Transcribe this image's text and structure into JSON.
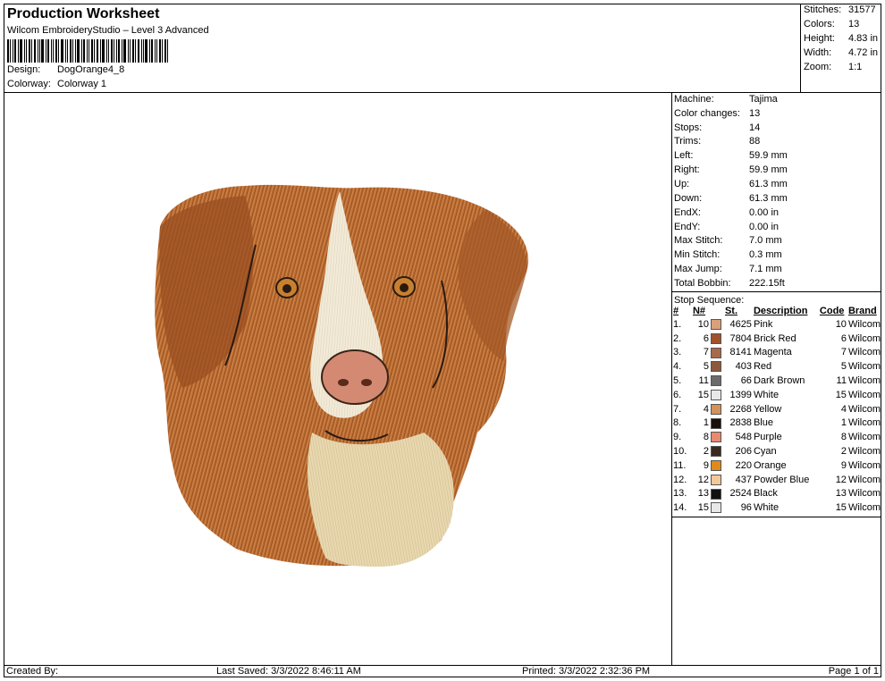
{
  "header": {
    "title": "Production Worksheet",
    "subtitle": "Wilcom EmbroideryStudio – Level 3 Advanced",
    "design_label": "Design:",
    "design_value": "DogOrange4_8",
    "colorway_label": "Colorway:",
    "colorway_value": "Colorway 1"
  },
  "stats": [
    {
      "label": "Stitches:",
      "value": "31577"
    },
    {
      "label": "Colors:",
      "value": "13"
    },
    {
      "label": "Height:",
      "value": "4.83 in"
    },
    {
      "label": "Width:",
      "value": "4.72 in"
    },
    {
      "label": "Zoom:",
      "value": "1:1"
    }
  ],
  "machine_info": [
    {
      "label": "Machine:",
      "value": "Tajima"
    },
    {
      "label": "Color changes:",
      "value": "13"
    },
    {
      "label": "Stops:",
      "value": "14"
    },
    {
      "label": "Trims:",
      "value": "88"
    },
    {
      "label": "Left:",
      "value": "59.9 mm"
    },
    {
      "label": "Right:",
      "value": "59.9 mm"
    },
    {
      "label": "Up:",
      "value": "61.3 mm"
    },
    {
      "label": "Down:",
      "value": "61.3 mm"
    },
    {
      "label": "EndX:",
      "value": "0.00 in"
    },
    {
      "label": "EndY:",
      "value": "0.00 in"
    },
    {
      "label": "Max Stitch:",
      "value": "7.0 mm"
    },
    {
      "label": "Min Stitch:",
      "value": "0.3 mm"
    },
    {
      "label": "Max Jump:",
      "value": "7.1 mm"
    },
    {
      "label": "Total Bobbin:",
      "value": "222.15ft"
    }
  ],
  "stop_sequence": {
    "title": "Stop Sequence:",
    "columns": [
      "#",
      "N#",
      "St.",
      "Description",
      "Code",
      "Brand"
    ],
    "rows": [
      {
        "num": "1.",
        "n": "10",
        "color": "#d9a07c",
        "st": "4625",
        "desc": "Pink",
        "code": "10",
        "brand": "Wilcom"
      },
      {
        "num": "2.",
        "n": "6",
        "color": "#a0522d",
        "st": "7804",
        "desc": "Brick Red",
        "code": "6",
        "brand": "Wilcom"
      },
      {
        "num": "3.",
        "n": "7",
        "color": "#a86a4a",
        "st": "8141",
        "desc": "Magenta",
        "code": "7",
        "brand": "Wilcom"
      },
      {
        "num": "4.",
        "n": "5",
        "color": "#8b5a3c",
        "st": "403",
        "desc": "Red",
        "code": "5",
        "brand": "Wilcom"
      },
      {
        "num": "5.",
        "n": "11",
        "color": "#6b6b6b",
        "st": "66",
        "desc": "Dark Brown",
        "code": "11",
        "brand": "Wilcom"
      },
      {
        "num": "6.",
        "n": "15",
        "color": "#e8e8e8",
        "st": "1399",
        "desc": "White",
        "code": "15",
        "brand": "Wilcom"
      },
      {
        "num": "7.",
        "n": "4",
        "color": "#d2935a",
        "st": "2268",
        "desc": "Yellow",
        "code": "4",
        "brand": "Wilcom"
      },
      {
        "num": "8.",
        "n": "1",
        "color": "#1a0f0a",
        "st": "2838",
        "desc": "Blue",
        "code": "1",
        "brand": "Wilcom"
      },
      {
        "num": "9.",
        "n": "8",
        "color": "#e88a70",
        "st": "548",
        "desc": "Purple",
        "code": "8",
        "brand": "Wilcom"
      },
      {
        "num": "10.",
        "n": "2",
        "color": "#3a2a22",
        "st": "206",
        "desc": "Cyan",
        "code": "2",
        "brand": "Wilcom"
      },
      {
        "num": "11.",
        "n": "9",
        "color": "#e08a1a",
        "st": "220",
        "desc": "Orange",
        "code": "9",
        "brand": "Wilcom"
      },
      {
        "num": "12.",
        "n": "12",
        "color": "#f2c89a",
        "st": "437",
        "desc": "Powder Blue",
        "code": "12",
        "brand": "Wilcom"
      },
      {
        "num": "13.",
        "n": "13",
        "color": "#111111",
        "st": "2524",
        "desc": "Black",
        "code": "13",
        "brand": "Wilcom"
      },
      {
        "num": "14.",
        "n": "15",
        "color": "#e8e8e8",
        "st": "96",
        "desc": "White",
        "code": "15",
        "brand": "Wilcom"
      }
    ]
  },
  "footer": {
    "created_by": "Created By:",
    "last_saved": "Last Saved: 3/3/2022 8:46:11 AM",
    "printed": "Printed: 3/3/2022 2:32:36 PM",
    "page": "Page 1 of 1"
  }
}
